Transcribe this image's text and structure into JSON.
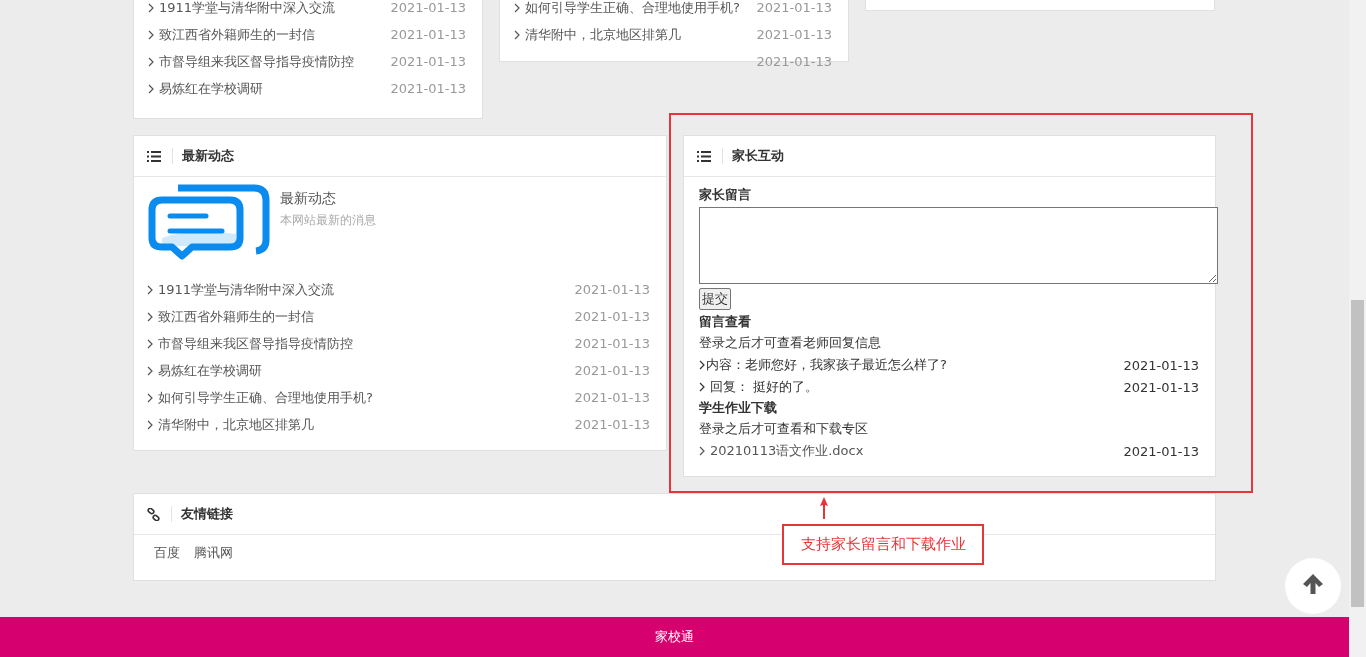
{
  "top_lists": [
    {
      "items": [
        {
          "title": "1911学堂与清华附中深入交流",
          "date": "2021-01-13"
        },
        {
          "title": "致江西省外籍师生的一封信",
          "date": "2021-01-13"
        },
        {
          "title": "市督导组来我区督导指导疫情防控",
          "date": "2021-01-13"
        },
        {
          "title": "易炼红在学校调研",
          "date": "2021-01-13"
        }
      ]
    },
    {
      "items": [
        {
          "title": "如何引导学生正确、合理地使用手机?",
          "date": "2021-01-13"
        },
        {
          "title": "清华附中，北京地区排第几",
          "date": "2021-01-13"
        }
      ],
      "overflow_date": "2021-01-13"
    }
  ],
  "news": {
    "title": "最新动态",
    "intro_title": "最新动态",
    "intro_subtitle": "本网站最新的消息",
    "items": [
      {
        "title": "1911学堂与清华附中深入交流",
        "date": "2021-01-13"
      },
      {
        "title": "致江西省外籍师生的一封信",
        "date": "2021-01-13"
      },
      {
        "title": "市督导组来我区督导指导疫情防控",
        "date": "2021-01-13"
      },
      {
        "title": "易炼红在学校调研",
        "date": "2021-01-13"
      },
      {
        "title": "如何引导学生正确、合理地使用手机?",
        "date": "2021-01-13"
      },
      {
        "title": "清华附中，北京地区排第几",
        "date": "2021-01-13"
      }
    ]
  },
  "parents": {
    "title": "家长互动",
    "message_label": "家长留言",
    "submit": "提交",
    "view_heading": "留言查看",
    "view_note": "登录之后才可查看老师回复信息",
    "messages": [
      {
        "kind": "content",
        "text": "内容：老师您好，我家孩子最近怎么样了?",
        "date": "2021-01-13"
      },
      {
        "kind": "reply",
        "text": "回复： 挺好的了。",
        "date": "2021-01-13"
      }
    ],
    "download_heading": "学生作业下载",
    "download_note": "登录之后才可查看和下载专区",
    "files": [
      {
        "name": "20210113语文作业.docx",
        "date": "2021-01-13"
      }
    ]
  },
  "links": {
    "title": "友情链接",
    "items": [
      "百度",
      "腾讯网"
    ]
  },
  "annotation": "支持家长留言和下载作业",
  "footer": "家校通"
}
